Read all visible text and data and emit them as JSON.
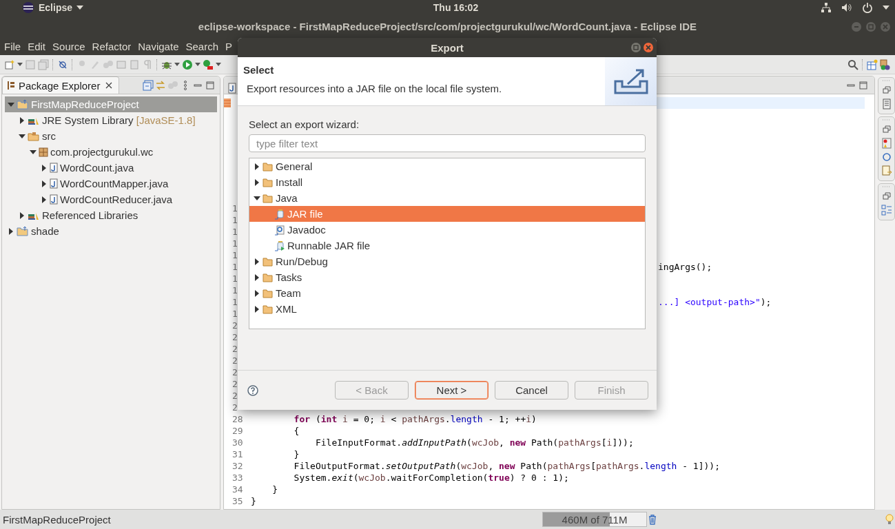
{
  "top_panel": {
    "app_menu": "Eclipse",
    "clock": "Thu 16:02"
  },
  "window": {
    "title": "eclipse-workspace - FirstMapReduceProject/src/com/projectgurukul/wc/WordCount.java - Eclipse IDE"
  },
  "menu": [
    "File",
    "Edit",
    "Source",
    "Refactor",
    "Navigate",
    "Search",
    "P"
  ],
  "package_explorer": {
    "title": "Package Explorer",
    "tree": [
      {
        "label": "FirstMapReduceProject",
        "kind": "project",
        "expanded": true,
        "selected": true,
        "children": [
          {
            "label": "JRE System Library",
            "decoration": "[JavaSE-1.8]",
            "kind": "library",
            "expanded": false,
            "selected": false
          },
          {
            "label": "src",
            "kind": "source-folder",
            "expanded": true,
            "selected": false,
            "children": [
              {
                "label": "com.projectgurukul.wc",
                "kind": "package",
                "expanded": true,
                "selected": false,
                "children": [
                  {
                    "label": "WordCount.java",
                    "kind": "java-file",
                    "expanded": false,
                    "selected": false
                  },
                  {
                    "label": "WordCountMapper.java",
                    "kind": "java-file",
                    "expanded": false,
                    "selected": false
                  },
                  {
                    "label": "WordCountReducer.java",
                    "kind": "java-file",
                    "expanded": false,
                    "selected": false
                  }
                ]
              }
            ]
          },
          {
            "label": "Referenced Libraries",
            "kind": "library",
            "expanded": false,
            "selected": false
          }
        ]
      },
      {
        "label": "shade",
        "kind": "project",
        "expanded": false,
        "selected": false
      }
    ]
  },
  "editor": {
    "lines": [
      {
        "current": true,
        "marker": true
      },
      {
        "current": false
      },
      {
        "current": false
      },
      {
        "current": false
      },
      {
        "current": false
      },
      {
        "current": false
      },
      {
        "current": false
      },
      {
        "current": false
      },
      {
        "current": false
      },
      {
        "current": false,
        "number": "1"
      },
      {
        "current": false,
        "number": "1"
      },
      {
        "current": false,
        "number": "1"
      },
      {
        "current": false,
        "number": "1"
      },
      {
        "current": false,
        "number": "1"
      },
      {
        "current": false,
        "number": "1",
        "tail": [
          {
            "text": "ingArgs();",
            "kind": "plain"
          }
        ]
      },
      {
        "current": false,
        "number": "1"
      },
      {
        "current": false,
        "number": "1"
      },
      {
        "current": false,
        "number": "1",
        "tail": [
          {
            "text": "...] <output-path>\"",
            "kind": "string"
          },
          {
            "text": ");",
            "kind": "plain"
          }
        ]
      },
      {
        "current": false,
        "number": "1"
      },
      {
        "current": false,
        "number": "2"
      },
      {
        "current": false,
        "number": "2"
      },
      {
        "current": false,
        "number": "2"
      },
      {
        "current": false,
        "number": "2"
      },
      {
        "current": false,
        "number": "2"
      },
      {
        "current": false,
        "number": "2"
      },
      {
        "current": false,
        "number": "2"
      },
      {
        "current": false,
        "number": "2"
      },
      {
        "current": false,
        "number": "28",
        "code": [
          {
            "text": "        for",
            "kind": "keyword"
          },
          {
            "text": " (",
            "kind": "plain"
          },
          {
            "text": "int ",
            "kind": "keyword"
          },
          {
            "text": "i",
            "kind": "variable"
          },
          {
            "text": " = 0; ",
            "kind": "plain"
          },
          {
            "text": "i",
            "kind": "variable"
          },
          {
            "text": " < ",
            "kind": "plain"
          },
          {
            "text": "pathArgs",
            "kind": "variable"
          },
          {
            "text": ".",
            "kind": "plain"
          },
          {
            "text": "length",
            "kind": "field"
          },
          {
            "text": " - 1; ++",
            "kind": "plain"
          },
          {
            "text": "i",
            "kind": "variable"
          },
          {
            "text": ")",
            "kind": "plain"
          }
        ]
      },
      {
        "current": false,
        "number": "29",
        "code": [
          {
            "text": "        {",
            "kind": "plain"
          }
        ]
      },
      {
        "current": false,
        "number": "30",
        "code": [
          {
            "text": "            FileInputFormat.",
            "kind": "plain"
          },
          {
            "text": "addInputPath",
            "kind": "static"
          },
          {
            "text": "(",
            "kind": "plain"
          },
          {
            "text": "wcJob",
            "kind": "variable"
          },
          {
            "text": ", ",
            "kind": "plain"
          },
          {
            "text": "new",
            "kind": "keyword"
          },
          {
            "text": " Path(",
            "kind": "plain"
          },
          {
            "text": "pathArgs",
            "kind": "variable"
          },
          {
            "text": "[",
            "kind": "plain"
          },
          {
            "text": "i",
            "kind": "variable"
          },
          {
            "text": "]));",
            "kind": "plain"
          }
        ]
      },
      {
        "current": false,
        "number": "31",
        "code": [
          {
            "text": "        }",
            "kind": "plain"
          }
        ]
      },
      {
        "current": false,
        "number": "32",
        "code": [
          {
            "text": "        FileOutputFormat.",
            "kind": "plain"
          },
          {
            "text": "setOutputPath",
            "kind": "static"
          },
          {
            "text": "(",
            "kind": "plain"
          },
          {
            "text": "wcJob",
            "kind": "variable"
          },
          {
            "text": ", ",
            "kind": "plain"
          },
          {
            "text": "new",
            "kind": "keyword"
          },
          {
            "text": " Path(",
            "kind": "plain"
          },
          {
            "text": "pathArgs",
            "kind": "variable"
          },
          {
            "text": "[",
            "kind": "plain"
          },
          {
            "text": "pathArgs",
            "kind": "variable"
          },
          {
            "text": ".",
            "kind": "plain"
          },
          {
            "text": "length",
            "kind": "field"
          },
          {
            "text": " - 1]));",
            "kind": "plain"
          }
        ]
      },
      {
        "current": false,
        "number": "33",
        "code": [
          {
            "text": "        System.",
            "kind": "plain"
          },
          {
            "text": "exit",
            "kind": "static"
          },
          {
            "text": "(",
            "kind": "plain"
          },
          {
            "text": "wcJob",
            "kind": "variable"
          },
          {
            "text": ".waitForCompletion(",
            "kind": "plain"
          },
          {
            "text": "true",
            "kind": "keyword"
          },
          {
            "text": ") ? 0 : 1);",
            "kind": "plain"
          }
        ]
      },
      {
        "current": false,
        "number": "34",
        "code": [
          {
            "text": "    }",
            "kind": "plain"
          }
        ]
      },
      {
        "current": false,
        "number": "35",
        "code": [
          {
            "text": "}",
            "kind": "plain"
          }
        ]
      }
    ]
  },
  "dialog": {
    "title": "Export",
    "page_title": "Select",
    "description": "Export resources into a JAR file on the local file system.",
    "filter_label": "Select an export wizard:",
    "filter": {
      "placeholder": "type filter text"
    },
    "wizards": [
      {
        "label": "General",
        "kind": "folder",
        "expanded": false,
        "selected": false
      },
      {
        "label": "Install",
        "kind": "folder",
        "expanded": false,
        "selected": false
      },
      {
        "label": "Java",
        "kind": "folder",
        "expanded": true,
        "selected": false,
        "children": [
          {
            "label": "JAR file",
            "kind": "jar",
            "selected": true
          },
          {
            "label": "Javadoc",
            "kind": "javadoc",
            "selected": false
          },
          {
            "label": "Runnable JAR file",
            "kind": "runnable-jar",
            "selected": false
          }
        ]
      },
      {
        "label": "Run/Debug",
        "kind": "folder",
        "expanded": false,
        "selected": false
      },
      {
        "label": "Tasks",
        "kind": "folder",
        "expanded": false,
        "selected": false
      },
      {
        "label": "Team",
        "kind": "folder",
        "expanded": false,
        "selected": false
      },
      {
        "label": "XML",
        "kind": "folder",
        "expanded": false,
        "selected": false
      }
    ],
    "buttons": [
      {
        "label": "< Back",
        "disabled": true,
        "default": false
      },
      {
        "label": "Next >",
        "disabled": false,
        "default": true
      },
      {
        "label": "Cancel",
        "disabled": false,
        "default": false
      },
      {
        "label": "Finish",
        "disabled": true,
        "default": false
      }
    ]
  },
  "status_bar": {
    "text": "FirstMapReduceProject",
    "heap": {
      "reading": "460M of 711M",
      "level": 0.647
    }
  }
}
